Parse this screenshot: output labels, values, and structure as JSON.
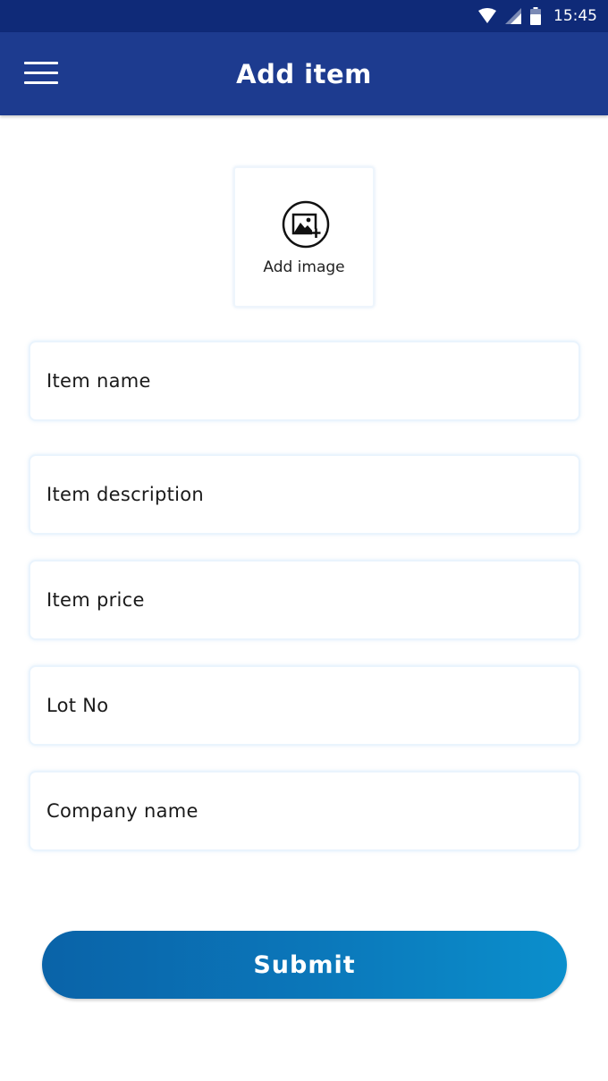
{
  "status_bar": {
    "time": "15:45",
    "icons": [
      "wifi-icon",
      "signal-icon",
      "battery-icon"
    ]
  },
  "header": {
    "title": "Add item",
    "menu_icon": "menu-icon"
  },
  "add_image": {
    "label": "Add image",
    "icon": "add-image-icon"
  },
  "form": {
    "fields": [
      {
        "label": "Item name"
      },
      {
        "label": "Item description"
      },
      {
        "label": "Item price"
      },
      {
        "label": "Lot No"
      },
      {
        "label": "Company name"
      }
    ]
  },
  "submit": {
    "label": "Submit"
  },
  "colors": {
    "status_bar": "#0f2a78",
    "app_bar": "#1d3b8f",
    "button_start": "#0a63a8",
    "button_end": "#0b8fcc"
  }
}
